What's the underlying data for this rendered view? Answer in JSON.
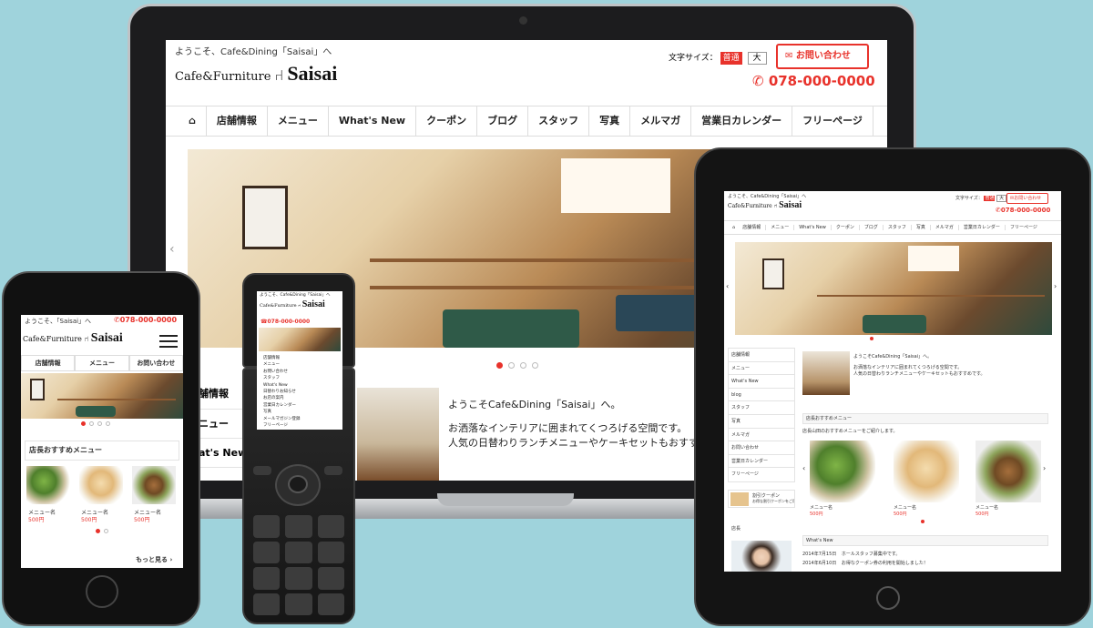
{
  "laptop": {
    "welcome": "ようこそ、Cafe&Dining「Saisai」へ",
    "logo_left": "Cafe&Furniture",
    "logo_right": "Saisai",
    "font_size_label": "文字サイズ：",
    "font_size_normal": "普通",
    "font_size_large": "大",
    "contact_button": "お問い合わせ",
    "phone": "078-000-0000",
    "nav": [
      "店舗情報",
      "メニュー",
      "What's New",
      "クーポン",
      "ブログ",
      "スタッフ",
      "写真",
      "メルマガ",
      "営業日カレンダー",
      "フリーページ"
    ],
    "side_items": [
      "舗情報",
      "ニュー",
      "at's New"
    ],
    "intro_title": "ようこそCafe&Dining「Saisai」へ。",
    "intro_line1": "お洒落なインテリアに囲まれてくつろげる空間です。",
    "intro_line2": "人気の日替わりランチメニューやケーキセットもおすすめで"
  },
  "tablet": {
    "welcome": "ようこそ、Cafe&Dining「Saisai」へ",
    "logo_left": "Cafe&Furniture",
    "logo_right": "Saisai",
    "font_size_label": "文字サイズ：",
    "font_size_normal": "普通",
    "font_size_large": "大",
    "contact_button": "お問い合わせ",
    "phone": "078-000-0000",
    "nav": [
      "店舗情報",
      "メニュー",
      "What's New",
      "クーポン",
      "ブログ",
      "スタッフ",
      "写真",
      "メルマガ",
      "営業日カレンダー",
      "フリーページ"
    ],
    "side_items": [
      "店舗情報",
      "メニュー",
      "What's New",
      "blog",
      "スタッフ",
      "写真",
      "メルマガ",
      "お問い合わせ",
      "営業日カレンダー",
      "フリーページ"
    ],
    "intro_title": "ようこそCafe&Dining「Saisai」へ。",
    "intro_line1": "お洒落なインテリアに囲まれてくつろげる空間です。",
    "intro_line2": "人気の日替わりランチメニューやケーキセットもおすすめです。",
    "recommend_heading": "店長おすすめメニュー",
    "recommend_text": "店長山田のおすすめメニューをご紹介します。",
    "menu_items": [
      {
        "name": "メニュー名",
        "price": "500円"
      },
      {
        "name": "メニュー名",
        "price": "500円"
      },
      {
        "name": "メニュー名",
        "price": "500円"
      }
    ],
    "coupon_title": "割引クーポン",
    "coupon_text": "お得な割引クーポンをご用意しております。",
    "staff_heading": "店長",
    "whats_new_heading": "What's New",
    "news": [
      {
        "date": "2014年7月15日",
        "text": "ホールスタッフ募集中です。"
      },
      {
        "date": "2014年6月10日",
        "text": "お得なクーポン券の利用を開始しました！"
      }
    ]
  },
  "phone_device": {
    "welcome": "ようこそ、「Saisai」へ",
    "phone": "078-000-0000",
    "logo_left": "Cafe&Furniture",
    "logo_right": "Saisai",
    "tabs": [
      "店舗情報",
      "メニュー",
      "お問い合わせ"
    ],
    "recommend_heading": "店長おすすめメニュー",
    "menu_items": [
      {
        "name": "メニュー名",
        "price": "500円"
      },
      {
        "name": "メニュー名",
        "price": "500円"
      },
      {
        "name": "メニュー名",
        "price": "500円"
      }
    ],
    "more_link": "もっと見る"
  },
  "feature_phone": {
    "welcome": "ようこそ、Cafe&Dining「Saisai」へ",
    "logo_left": "Cafe&Furniture",
    "logo_right": "Saisai",
    "phone": "078-000-0000",
    "menu": [
      "店舗情報",
      "メニュー",
      "お問い合わせ",
      "スタッフ",
      "What's New",
      "日替わりお知らせ",
      "お店の案内",
      "営業日カレンダー",
      "写真",
      "メールマガジン登録",
      "フリーページ"
    ]
  },
  "colors": {
    "accent_red": "#e8322b",
    "background": "#9fd3dc"
  }
}
